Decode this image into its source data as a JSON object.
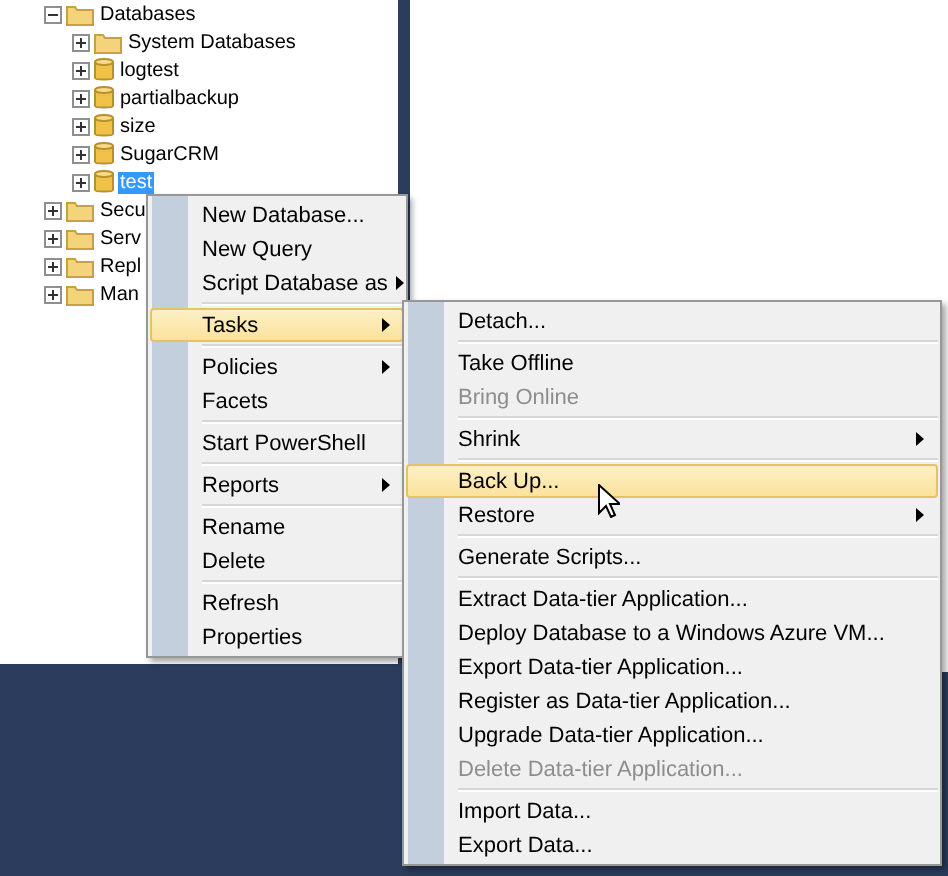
{
  "tree": [
    {
      "label": "Databases",
      "kind": "folder",
      "expanded": true,
      "selected": false,
      "children": [
        {
          "label": "System Databases",
          "kind": "folder",
          "expanded": false,
          "selected": false
        },
        {
          "label": "logtest",
          "kind": "database",
          "expanded": false,
          "selected": false
        },
        {
          "label": "partialbackup",
          "kind": "database",
          "expanded": false,
          "selected": false
        },
        {
          "label": "size",
          "kind": "database",
          "expanded": false,
          "selected": false
        },
        {
          "label": "SugarCRM",
          "kind": "database",
          "expanded": false,
          "selected": false
        },
        {
          "label": "test",
          "kind": "database",
          "expanded": false,
          "selected": true
        }
      ]
    },
    {
      "label": "Secu",
      "kind": "folder",
      "expanded": false,
      "selected": false
    },
    {
      "label": "Serv",
      "kind": "folder",
      "expanded": false,
      "selected": false
    },
    {
      "label": "Repl",
      "kind": "folder",
      "expanded": false,
      "selected": false
    },
    {
      "label": "Man",
      "kind": "folder",
      "expanded": false,
      "selected": false
    }
  ],
  "context_menu": [
    {
      "kind": "item",
      "label": "New Database...",
      "submenu": false,
      "disabled": false,
      "selected": false
    },
    {
      "kind": "item",
      "label": "New Query",
      "submenu": false,
      "disabled": false,
      "selected": false
    },
    {
      "kind": "item",
      "label": "Script Database as",
      "submenu": true,
      "disabled": false,
      "selected": false
    },
    {
      "kind": "separator"
    },
    {
      "kind": "item",
      "label": "Tasks",
      "submenu": true,
      "disabled": false,
      "selected": true
    },
    {
      "kind": "separator"
    },
    {
      "kind": "item",
      "label": "Policies",
      "submenu": true,
      "disabled": false,
      "selected": false
    },
    {
      "kind": "item",
      "label": "Facets",
      "submenu": false,
      "disabled": false,
      "selected": false
    },
    {
      "kind": "separator"
    },
    {
      "kind": "item",
      "label": "Start PowerShell",
      "submenu": false,
      "disabled": false,
      "selected": false
    },
    {
      "kind": "separator"
    },
    {
      "kind": "item",
      "label": "Reports",
      "submenu": true,
      "disabled": false,
      "selected": false
    },
    {
      "kind": "separator"
    },
    {
      "kind": "item",
      "label": "Rename",
      "submenu": false,
      "disabled": false,
      "selected": false
    },
    {
      "kind": "item",
      "label": "Delete",
      "submenu": false,
      "disabled": false,
      "selected": false
    },
    {
      "kind": "separator"
    },
    {
      "kind": "item",
      "label": "Refresh",
      "submenu": false,
      "disabled": false,
      "selected": false
    },
    {
      "kind": "item",
      "label": "Properties",
      "submenu": false,
      "disabled": false,
      "selected": false
    }
  ],
  "tasks_submenu": [
    {
      "kind": "item",
      "label": "Detach...",
      "submenu": false,
      "disabled": false,
      "selected": false
    },
    {
      "kind": "separator"
    },
    {
      "kind": "item",
      "label": "Take Offline",
      "submenu": false,
      "disabled": false,
      "selected": false
    },
    {
      "kind": "item",
      "label": "Bring Online",
      "submenu": false,
      "disabled": true,
      "selected": false
    },
    {
      "kind": "separator"
    },
    {
      "kind": "item",
      "label": "Shrink",
      "submenu": true,
      "disabled": false,
      "selected": false
    },
    {
      "kind": "separator"
    },
    {
      "kind": "item",
      "label": "Back Up...",
      "submenu": false,
      "disabled": false,
      "selected": true
    },
    {
      "kind": "item",
      "label": "Restore",
      "submenu": true,
      "disabled": false,
      "selected": false
    },
    {
      "kind": "separator"
    },
    {
      "kind": "item",
      "label": "Generate Scripts...",
      "submenu": false,
      "disabled": false,
      "selected": false
    },
    {
      "kind": "separator"
    },
    {
      "kind": "item",
      "label": "Extract Data-tier Application...",
      "submenu": false,
      "disabled": false,
      "selected": false
    },
    {
      "kind": "item",
      "label": "Deploy Database to a Windows Azure VM...",
      "submenu": false,
      "disabled": false,
      "selected": false
    },
    {
      "kind": "item",
      "label": "Export Data-tier Application...",
      "submenu": false,
      "disabled": false,
      "selected": false
    },
    {
      "kind": "item",
      "label": "Register as Data-tier Application...",
      "submenu": false,
      "disabled": false,
      "selected": false
    },
    {
      "kind": "item",
      "label": "Upgrade Data-tier Application...",
      "submenu": false,
      "disabled": false,
      "selected": false
    },
    {
      "kind": "item",
      "label": "Delete Data-tier Application...",
      "submenu": false,
      "disabled": true,
      "selected": false
    },
    {
      "kind": "separator"
    },
    {
      "kind": "item",
      "label": "Import Data...",
      "submenu": false,
      "disabled": false,
      "selected": false
    },
    {
      "kind": "item",
      "label": "Export Data...",
      "submenu": false,
      "disabled": false,
      "selected": false
    }
  ]
}
